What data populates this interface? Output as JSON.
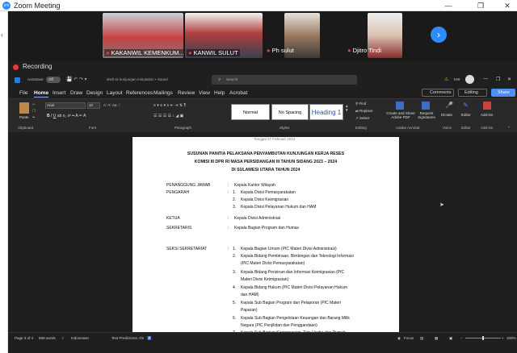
{
  "zoom": {
    "title": "Zoom Meeting",
    "participants": [
      {
        "name": "KAKANWIL KEMENKUM..."
      },
      {
        "name": "KANWIL SULUT"
      },
      {
        "name": "Ph sulut"
      },
      {
        "name": "Djitro Tindi"
      }
    ],
    "recording_label": "Recording"
  },
  "word": {
    "autosave": "AutoSave",
    "toggle": "Off",
    "filename": "draft sk kunjungan minutation • Saved",
    "search_placeholder": "Search",
    "user_initials": "KW",
    "menus": [
      "File",
      "Home",
      "Insert",
      "Draw",
      "Design",
      "Layout",
      "References",
      "Mailings",
      "Review",
      "View",
      "Help",
      "Acrobat"
    ],
    "comments": "Comments",
    "editing": "Editing",
    "share": "Share",
    "ribbon": {
      "paste": "Paste",
      "font": "Arial",
      "size": "10",
      "styles": [
        "Normal",
        "No Spacing",
        "Heading 1"
      ],
      "find": "Find",
      "replace": "Replace",
      "select": "Select",
      "create_share": "Create and Share Adobe PDF",
      "request_sign": "Request Signatures",
      "dictate": "Dictate",
      "editor": "Editor",
      "addins": "Add-ins",
      "groups": [
        "Clipboard",
        "Font",
        "Paragraph",
        "Styles",
        "Editing",
        "Adobe Acrobat",
        "Voice",
        "Editor",
        "Add-ins"
      ]
    },
    "status": {
      "page": "Page 3 of 4",
      "words": "659 words",
      "language": "Indonesian",
      "text_predictions": "Text Predictions: On",
      "focus": "Focus",
      "zoom": "100%"
    }
  },
  "document": {
    "header_lines": [
      "SUSUNAN PANITIA PELAKSANA PENYAMBUTAN KUNJUNGAN KERJA RESES",
      "KOMISI III DPR RI MASA PERSIDANGAN III TAHUN SIDANG 2023 – 2024",
      "DI SULAWESI UTARA TAHUN 2024"
    ],
    "top_fragment": "Tanggal    27 Februari 2024",
    "sections": [
      {
        "label": "PENANGGUNG JAWAB",
        "items": [
          {
            "num": "",
            "text": "Kepala Kantor Wilayah"
          }
        ]
      },
      {
        "label": "PENGARAH",
        "items": [
          {
            "num": "1.",
            "text": "Kepala Divisi Pemasyarakatan"
          },
          {
            "num": "2.",
            "text": "Kepala Divisi Keimigrasian"
          },
          {
            "num": "3.",
            "text": "Kepala Divisi Pelayanan Hukum dan HAM"
          }
        ]
      },
      {
        "label": "KETUA",
        "items": [
          {
            "num": "",
            "text": "Kepala Divisi Administrasi"
          }
        ]
      },
      {
        "label": "SEKRETARIS",
        "items": [
          {
            "num": "",
            "text": "Kepala Bagian Program dan Humas"
          }
        ]
      },
      {
        "label": "SEKSI SEKRETARIAT",
        "items": [
          {
            "num": "1.",
            "text": "Kepala Bagian Umum (PIC Materi Divisi Administrasi)"
          },
          {
            "num": "2.",
            "text": "Kepala Bidang Pembinaan, Bimbingan dan Teknologi Informasi"
          },
          {
            "num": "",
            "text": "(PIC Materi Divisi Pemasyarakatan)"
          },
          {
            "num": "3.",
            "text": "Kepala Bidang Perizinan dan Informasi Keimigrasian (PIC"
          },
          {
            "num": "",
            "text": "Materi Divisi Keimigrasian)"
          },
          {
            "num": "4.",
            "text": "Kepala Bidang Hukum (PIC Materi Divisi Pelayanan Hukum"
          },
          {
            "num": "",
            "text": "dan HAM)"
          },
          {
            "num": "5.",
            "text": "Kepala Sub Bagian Program dan Pelaporan (PIC Materi"
          },
          {
            "num": "",
            "text": "Paparan)"
          },
          {
            "num": "6.",
            "text": "Kepala Sub Bagian Pengelolaan Keuangan dan Barang Milik"
          },
          {
            "num": "",
            "text": "Negara (PIC Penjilidan dan Penggandaan)"
          },
          {
            "num": "7.",
            "text": "Kepala Sub Bagian Kepegawaian, Tata Usaha dan Rumah"
          }
        ]
      }
    ]
  },
  "colors": {
    "accent": "#2d8cff",
    "record": "#e5393c",
    "share": "#4f8ef7"
  }
}
